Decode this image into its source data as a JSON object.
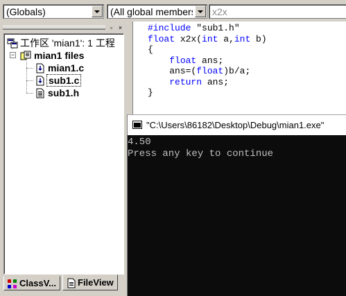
{
  "toolbar": {
    "scope_combo": "(Globals)",
    "members_combo": "(All global members",
    "function_combo": "x2x"
  },
  "workspace": {
    "root_label": "工作区 'mian1': 1 工程",
    "folder_label": "mian1 files",
    "files": [
      "mian1.c",
      "sub1.c",
      "sub1.h"
    ],
    "min_glyph": "▫",
    "close_glyph": "×",
    "tabs": {
      "classview": "ClassV...",
      "fileview": "FileView"
    }
  },
  "editor": {
    "lines": [
      {
        "parts": [
          {
            "t": "#include",
            "k": true
          },
          {
            "t": " \"sub1.h\"",
            "k": false
          }
        ]
      },
      {
        "parts": [
          {
            "t": "float",
            "k": true
          },
          {
            "t": " x2x(",
            "k": false
          },
          {
            "t": "int",
            "k": true
          },
          {
            "t": " a,",
            "k": false
          },
          {
            "t": "int",
            "k": true
          },
          {
            "t": " b)",
            "k": false
          }
        ]
      },
      {
        "parts": [
          {
            "t": "{",
            "k": false
          }
        ]
      },
      {
        "parts": [
          {
            "t": "    ",
            "k": false
          },
          {
            "t": "float",
            "k": true
          },
          {
            "t": " ans;",
            "k": false
          }
        ]
      },
      {
        "parts": [
          {
            "t": "    ans=(",
            "k": false
          },
          {
            "t": "float",
            "k": true
          },
          {
            "t": ")b/a;",
            "k": false
          }
        ]
      },
      {
        "parts": [
          {
            "t": "    ",
            "k": false
          },
          {
            "t": "return",
            "k": true
          },
          {
            "t": " ans;",
            "k": false
          }
        ]
      },
      {
        "parts": [
          {
            "t": "}",
            "k": false
          }
        ]
      }
    ]
  },
  "console": {
    "title": "\"C:\\Users\\86182\\Desktop\\Debug\\mian1.exe\"",
    "output": "4.50",
    "message": "Press any key to continue"
  },
  "colors": {
    "keyword": "#0000ff",
    "console_bg": "#0c0c0c",
    "console_text": "#c0c0c0",
    "chrome": "#d4d0c8"
  },
  "icons": {
    "root": "workspace-icon",
    "folder": "project-files-icon",
    "source": "c-source-file-icon",
    "header": "header-file-icon"
  }
}
